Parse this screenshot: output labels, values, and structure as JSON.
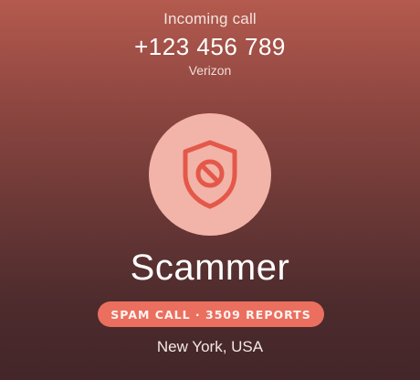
{
  "call": {
    "status_label": "Incoming call",
    "phone_number": "+123 456 789",
    "carrier": "Verizon"
  },
  "caller": {
    "name": "Scammer",
    "avatar_icon": "shield-block-icon",
    "location": "New York, USA"
  },
  "spam_badge": {
    "text": "SPAM CALL · 3509 REPORTS"
  },
  "colors": {
    "background_top": "#b45a4e",
    "background_bottom": "#432629",
    "avatar_bg": "#f2b4a8",
    "icon_stroke": "#e4584a",
    "badge_bg": "#ea6f5f"
  }
}
